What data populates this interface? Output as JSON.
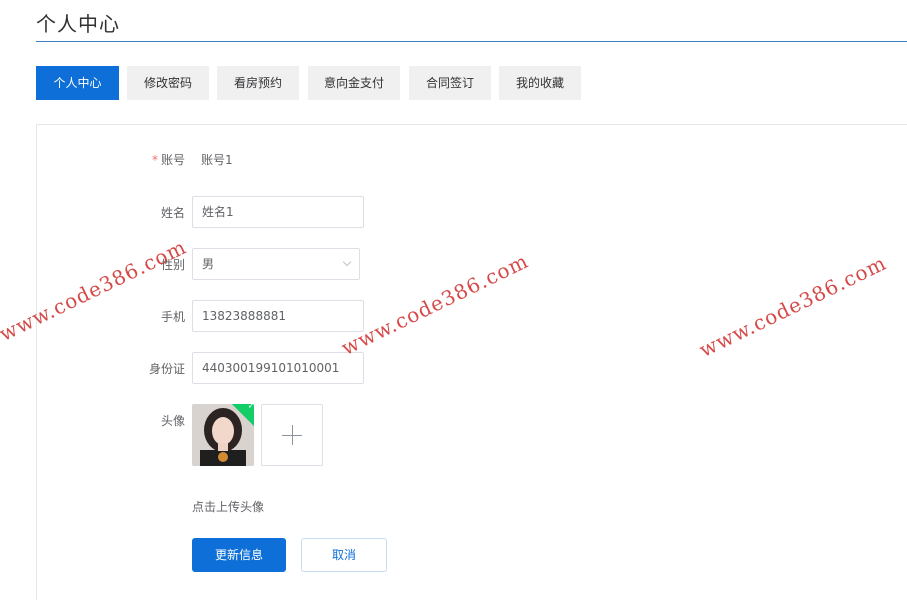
{
  "header": {
    "title": "个人中心"
  },
  "tabs": [
    {
      "label": "个人中心",
      "active": true
    },
    {
      "label": "修改密码",
      "active": false
    },
    {
      "label": "看房预约",
      "active": false
    },
    {
      "label": "意向金支付",
      "active": false
    },
    {
      "label": "合同签订",
      "active": false
    },
    {
      "label": "我的收藏",
      "active": false
    }
  ],
  "form": {
    "account": {
      "required_mark": "*",
      "label": "账号",
      "value": "账号1"
    },
    "name": {
      "label": "姓名",
      "value": "姓名1"
    },
    "gender": {
      "label": "性别",
      "value": "男"
    },
    "phone": {
      "label": "手机",
      "value": "13823888881"
    },
    "id_card": {
      "label": "身份证",
      "value": "440300199101010001"
    },
    "avatar": {
      "label": "头像",
      "upload_hint": "点击上传头像"
    }
  },
  "actions": {
    "update_label": "更新信息",
    "cancel_label": "取消"
  },
  "watermark": {
    "text": "www.code386.com"
  },
  "colors": {
    "primary": "#0e6fd8",
    "watermark": "#cf2a2a",
    "success": "#13ce66"
  },
  "icons": {
    "select": "chevron-down-icon",
    "upload": "plus-icon",
    "uploaded": "check-icon"
  }
}
